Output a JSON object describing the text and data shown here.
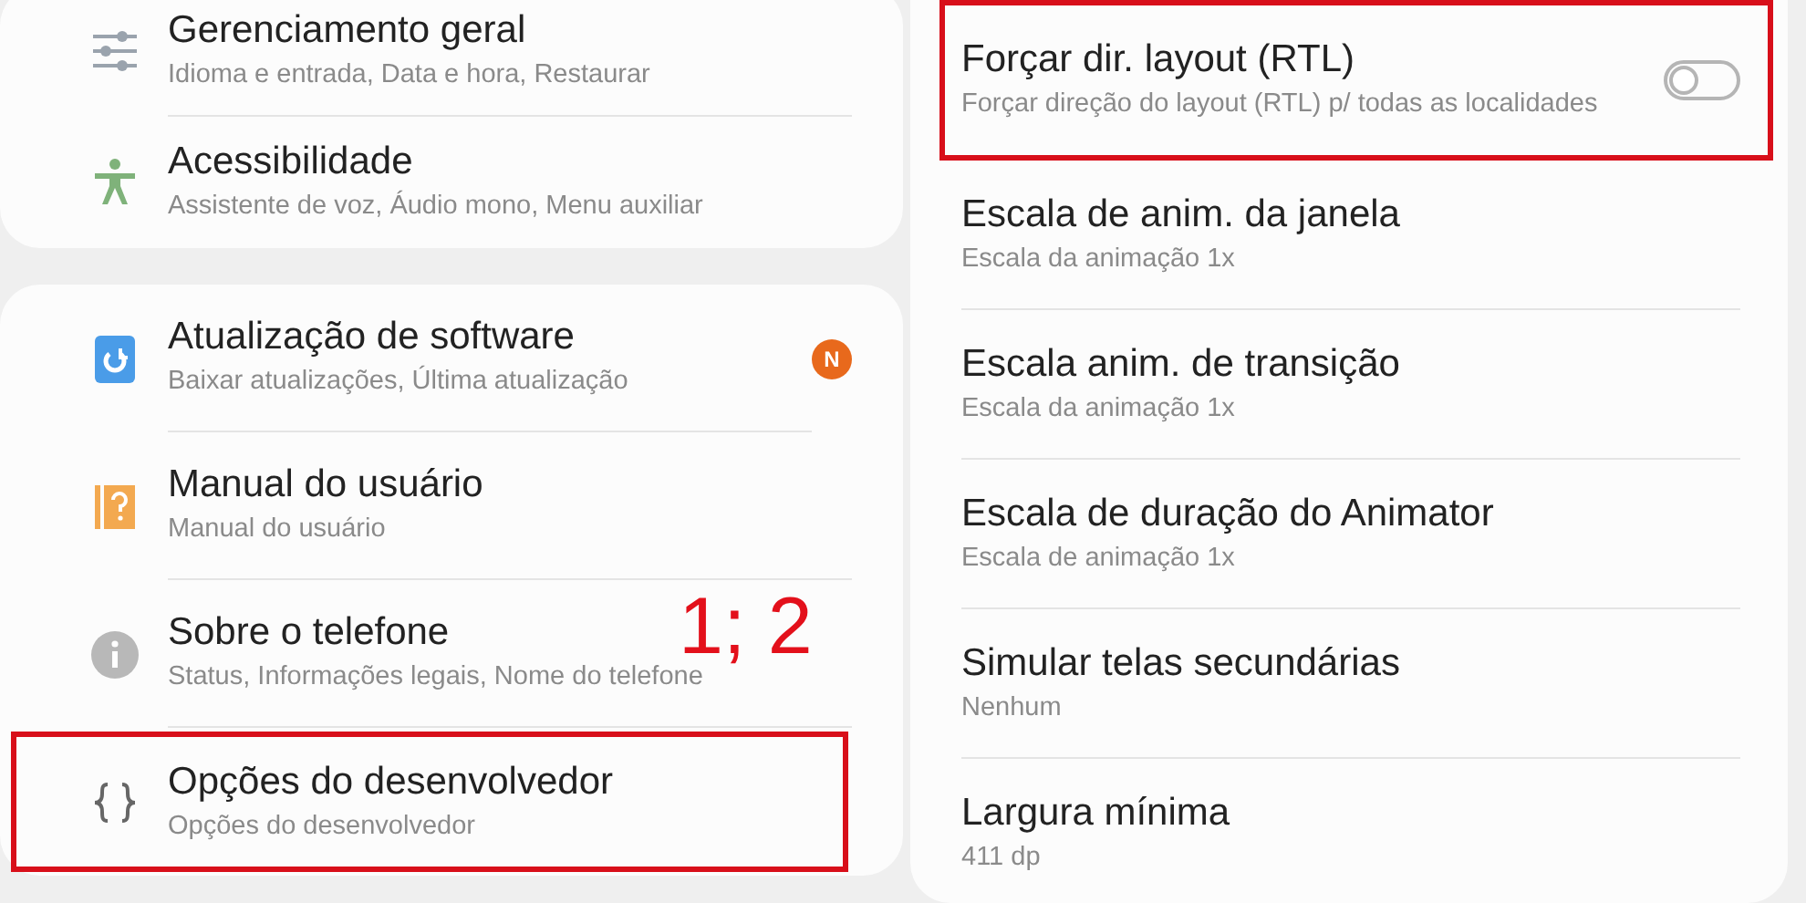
{
  "left_panel": {
    "groups": [
      {
        "items": [
          {
            "kind": "sliders",
            "title": "Gerenciamento geral",
            "subtitle": "Idioma e entrada, Data e hora, Restaurar",
            "highlighted": false
          },
          {
            "kind": "accessibility",
            "title": "Acessibilidade",
            "subtitle": "Assistente de voz, Áudio mono, Menu auxiliar",
            "highlighted": false
          }
        ]
      },
      {
        "items": [
          {
            "kind": "update",
            "title": "Atualização de software",
            "subtitle": "Baixar atualizações, Última atualização",
            "badge": "N",
            "highlighted": false
          },
          {
            "kind": "manual",
            "title": "Manual do usuário",
            "subtitle": "Manual do usuário",
            "highlighted": false
          },
          {
            "kind": "info",
            "title": "Sobre o telefone",
            "subtitle": "Status, Informações legais, Nome do telefone",
            "highlighted": false
          },
          {
            "kind": "braces",
            "title": "Opções do desenvolvedor",
            "subtitle": "Opções do desenvolvedor",
            "highlighted": true
          }
        ]
      }
    ]
  },
  "annotation": "1; 2",
  "right_panel": {
    "items": [
      {
        "title": "Forçar dir. layout (RTL)",
        "subtitle": "Forçar direção do layout (RTL) p/ todas as localidades",
        "toggle": {
          "on": false
        },
        "highlighted": true
      },
      {
        "title": "Escala de anim. da janela",
        "subtitle": "Escala da animação 1x",
        "highlighted": false
      },
      {
        "title": "Escala anim. de transição",
        "subtitle": "Escala da animação 1x",
        "highlighted": false
      },
      {
        "title": "Escala de duração do Animator",
        "subtitle": "Escala de animação 1x",
        "highlighted": false
      },
      {
        "title": "Simular telas secundárias",
        "subtitle": "Nenhum",
        "highlighted": false
      },
      {
        "title": "Largura mínima",
        "subtitle": "411 dp",
        "highlighted": false
      }
    ]
  }
}
